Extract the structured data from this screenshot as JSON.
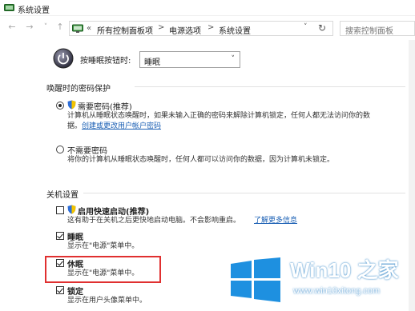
{
  "window": {
    "title": "系统设置"
  },
  "nav": {
    "back": "←",
    "forward": "→",
    "dropdown": "˅",
    "up": "↑",
    "breadcrumb_prefix": "«",
    "breadcrumb": [
      "所有控制面板项",
      "电源选项",
      "系统设置"
    ],
    "separator": ">",
    "address_dropdown": "˅",
    "refresh": "↻",
    "search_placeholder": "搜索控制面板"
  },
  "power_button": {
    "label": "按睡眠按钮时:",
    "value": "睡眠",
    "arrow": "˅"
  },
  "password_section": {
    "heading": "唤醒时的密码保护",
    "require": {
      "label": "需要密码(推荐)",
      "checked": true,
      "desc_line1": "计算机从睡眠状态唤醒时，如果未输入正确的密码来解除计算机锁定，任何人都无法访问你的数",
      "desc_line2": "据。",
      "link": "创建或更改用户帐户密码"
    },
    "no_require": {
      "label": "不需要密码",
      "checked": false,
      "desc": "将你的计算机从睡眠状态唤醒时，任何人都可以访问你的数据，因为计算机未锁定。"
    }
  },
  "shutdown_section": {
    "heading": "关机设置",
    "items": [
      {
        "label": "启用快速启动(推荐)",
        "checked": false,
        "desc": "这有助于在关机之后更快地启动电脑。不会影响重启。",
        "link": "了解更多信息"
      },
      {
        "label": "睡眠",
        "checked": true,
        "desc": "显示在\"电源\"菜单中。"
      },
      {
        "label": "休眠",
        "checked": true,
        "desc": "显示在\"电源\"菜单中。"
      },
      {
        "label": "锁定",
        "checked": true,
        "desc": "显示在用户头像菜单中。"
      }
    ]
  },
  "watermark": {
    "brand_prefix": "Win10",
    "brand_suffix": "之家",
    "url": "www.win10xitong.com"
  },
  "colors": {
    "highlight_border": "#e03030",
    "link": "#1a5fb4",
    "win_logo": "#1e90e0"
  }
}
